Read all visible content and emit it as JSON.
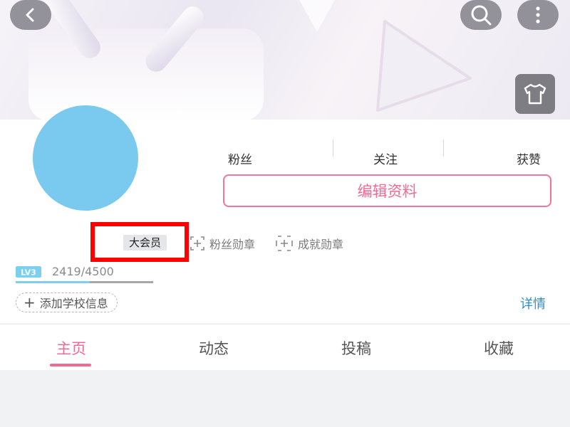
{
  "icons": {
    "back": "back-icon",
    "search": "search-icon",
    "more": "more-icon",
    "theme": "tshirt-icon",
    "fan_medal": "add-box-icon",
    "achievement": "add-box-icon"
  },
  "colors": {
    "accent_pink": "#f06a92",
    "link_blue": "#2f8fd1",
    "avatar": "#7ac9ef",
    "highlight": "#ff0000"
  },
  "stats": {
    "fans_label": "粉丝",
    "following_label": "关注",
    "likes_label": "获赞"
  },
  "edit_profile_label": "编辑资料",
  "badges": {
    "vip": "大会员",
    "fan_medal": "粉丝勋章",
    "achievement_medal": "成就勋章"
  },
  "level": {
    "badge": "LV3",
    "exp_text": "2419/4500",
    "progress": 0.54
  },
  "school_label": "添加学校信息",
  "details_label": "详情",
  "tabs": [
    {
      "label": "主页",
      "active": true
    },
    {
      "label": "动态",
      "active": false
    },
    {
      "label": "投稿",
      "active": false
    },
    {
      "label": "收藏",
      "active": false
    }
  ]
}
